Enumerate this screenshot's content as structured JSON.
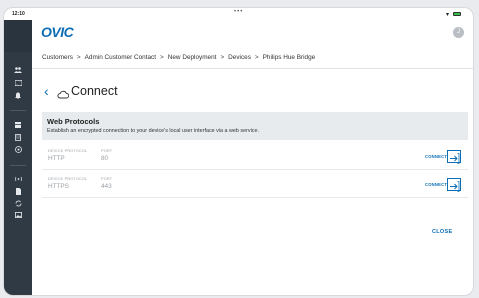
{
  "status_bar": {
    "time": "12:10",
    "dots": "•••"
  },
  "logo": {
    "text": "OVIC"
  },
  "profile": {
    "initial": "J"
  },
  "breadcrumb": {
    "items": [
      "Customers",
      "Admin Customer Contact",
      "New Deployment",
      "Devices",
      "Philips Hue Bridge"
    ],
    "separator": ">"
  },
  "page": {
    "title": "Connect"
  },
  "web_protocols": {
    "heading": "Web Protocols",
    "description": "Establish an encrypted connection to your device's local user interface via a web service."
  },
  "protocols": [
    {
      "protocol_label": "DEVICE PROTOCOL",
      "protocol": "HTTP",
      "port_label": "PORT",
      "port": "80",
      "connect_label": "CONNECT"
    },
    {
      "protocol_label": "DEVICE PROTOCOL",
      "protocol": "HTTPS",
      "port_label": "PORT",
      "port": "443",
      "connect_label": "CONNECT"
    }
  ],
  "footer": {
    "close_label": "CLOSE"
  },
  "colors": {
    "accent": "#0d6eb5",
    "sidebar": "#2f3a45",
    "section_bg": "#e8ebee"
  }
}
